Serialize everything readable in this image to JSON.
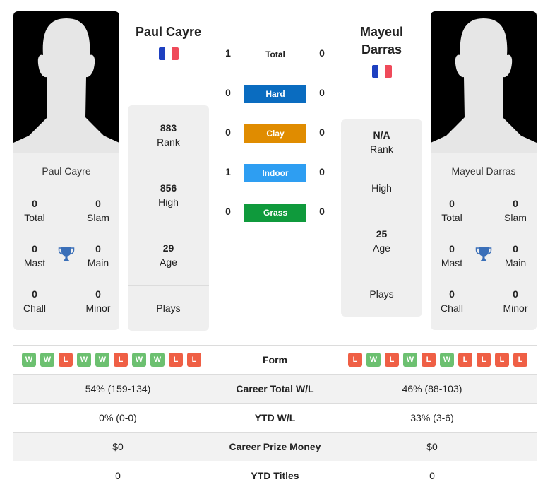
{
  "colors": {
    "hard": "#0a6cc0",
    "clay": "#e08c00",
    "indoor": "#2e9ef2",
    "grass": "#0f9a3c",
    "win": "#6cc070",
    "loss": "#ef5f45",
    "trophy": "#3a6fb8"
  },
  "player1": {
    "name": "Paul Cayre",
    "country": "France",
    "flag_icon": "france-flag-icon",
    "card_name": "Paul Cayre",
    "titles": {
      "total": {
        "value": "0",
        "label": "Total"
      },
      "slam": {
        "value": "0",
        "label": "Slam"
      },
      "mast": {
        "value": "0",
        "label": "Mast"
      },
      "main": {
        "value": "0",
        "label": "Main"
      },
      "chall": {
        "value": "0",
        "label": "Chall"
      },
      "minor": {
        "value": "0",
        "label": "Minor"
      }
    },
    "stats": {
      "rank": {
        "value": "883",
        "label": "Rank"
      },
      "high": {
        "value": "856",
        "label": "High"
      },
      "age": {
        "value": "29",
        "label": "Age"
      },
      "plays": {
        "value": "",
        "label": "Plays"
      }
    },
    "form": [
      "W",
      "W",
      "L",
      "W",
      "W",
      "L",
      "W",
      "W",
      "L",
      "L"
    ],
    "career_wl": "54% (159-134)",
    "ytd_wl": "0% (0-0)",
    "prize_money": "$0",
    "ytd_titles": "0"
  },
  "player2": {
    "name_line1": "Mayeul",
    "name_line2": "Darras",
    "country": "France",
    "flag_icon": "france-flag-icon",
    "card_name": "Mayeul Darras",
    "titles": {
      "total": {
        "value": "0",
        "label": "Total"
      },
      "slam": {
        "value": "0",
        "label": "Slam"
      },
      "mast": {
        "value": "0",
        "label": "Mast"
      },
      "main": {
        "value": "0",
        "label": "Main"
      },
      "chall": {
        "value": "0",
        "label": "Chall"
      },
      "minor": {
        "value": "0",
        "label": "Minor"
      }
    },
    "stats": {
      "rank": {
        "value": "N/A",
        "label": "Rank"
      },
      "high": {
        "value": "",
        "label": "High"
      },
      "age": {
        "value": "25",
        "label": "Age"
      },
      "plays": {
        "value": "",
        "label": "Plays"
      }
    },
    "form": [
      "L",
      "W",
      "L",
      "W",
      "L",
      "W",
      "L",
      "L",
      "L",
      "L"
    ],
    "career_wl": "46% (88-103)",
    "ytd_wl": "33% (3-6)",
    "prize_money": "$0",
    "ytd_titles": "0"
  },
  "h2h": {
    "total": {
      "label": "Total",
      "p1": "1",
      "p2": "0"
    },
    "hard": {
      "label": "Hard",
      "p1": "0",
      "p2": "0"
    },
    "clay": {
      "label": "Clay",
      "p1": "0",
      "p2": "0"
    },
    "indoor": {
      "label": "Indoor",
      "p1": "1",
      "p2": "0"
    },
    "grass": {
      "label": "Grass",
      "p1": "0",
      "p2": "0"
    }
  },
  "table": {
    "form_label": "Form",
    "career_wl_label": "Career Total W/L",
    "ytd_wl_label": "YTD W/L",
    "prize_label": "Career Prize Money",
    "ytd_titles_label": "YTD Titles"
  }
}
